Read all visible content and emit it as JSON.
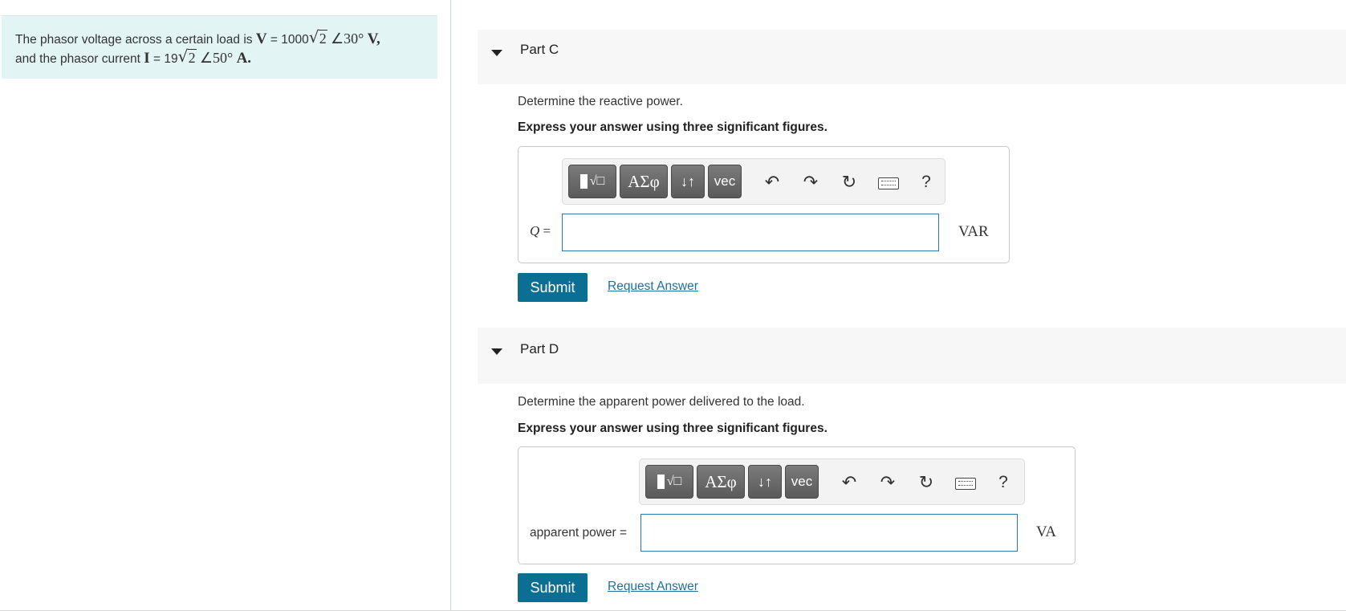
{
  "problem": {
    "text_1": "The phasor voltage across a certain load is ",
    "v_symbol": "V",
    "v_eq": " = 1000",
    "v_rad": "2",
    "v_angle": "∠30°",
    "v_unit": "V,",
    "text_2": "and the phasor current ",
    "i_symbol": "I",
    "i_eq": " = 19",
    "i_rad": "2",
    "i_angle": "∠50°",
    "i_unit": "A."
  },
  "toolbar": {
    "greek_label": "ΑΣφ",
    "arrows_label": "↓↑",
    "vec_label": "vec",
    "undo_glyph": "↶",
    "redo_glyph": "↷",
    "reset_glyph": "↻",
    "help_label": "?"
  },
  "part_c": {
    "title": "Part C",
    "prompt": "Determine the reactive power.",
    "instruction": "Express your answer using three significant figures.",
    "var_symbol": "Q",
    "var_eq": " =",
    "input_value": "",
    "unit": "VAR",
    "submit_label": "Submit",
    "request_label": "Request Answer"
  },
  "part_d": {
    "title": "Part D",
    "prompt": "Determine the apparent power delivered to the load.",
    "instruction": "Express your answer using three significant figures.",
    "var_label": "apparent power =",
    "input_value": "",
    "unit": "VA",
    "submit_label": "Submit",
    "request_label": "Request Answer"
  },
  "colors": {
    "problem_bg": "#e3f4f5",
    "header_bg": "#f7f7f7",
    "submit_bg": "#0a6f93",
    "link": "#1f6f9d",
    "input_border": "#2a7aa8"
  }
}
